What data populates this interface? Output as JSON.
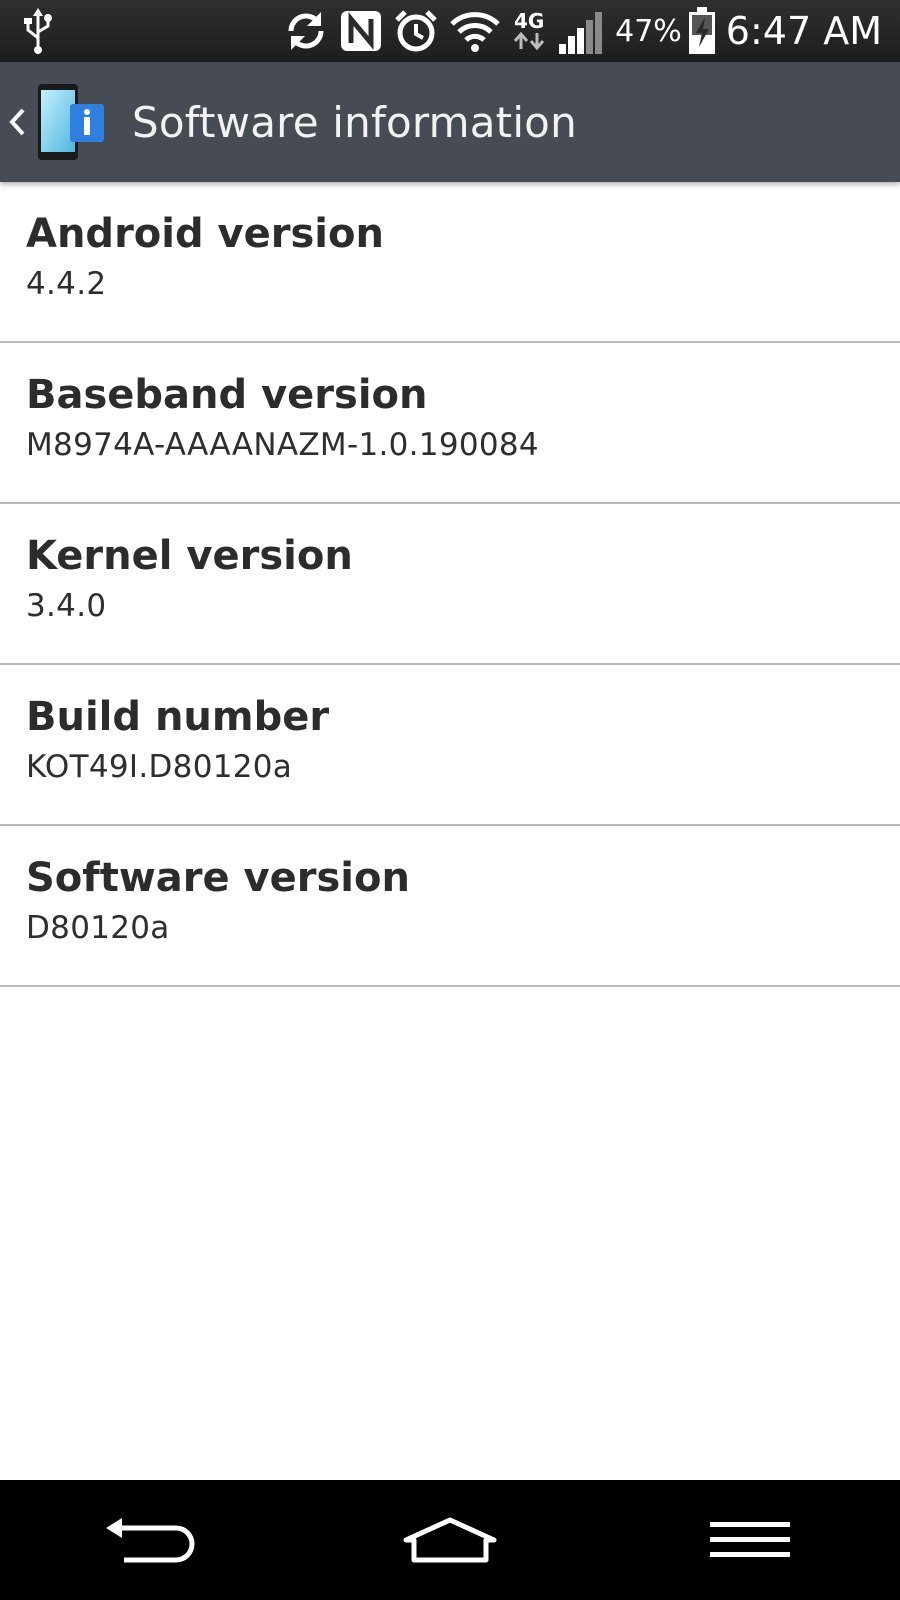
{
  "status_bar": {
    "icons": [
      "usb-icon",
      "sync-icon",
      "nfc-icon",
      "alarm-icon",
      "wifi-icon",
      "network-4g-icon",
      "signal-icon",
      "battery-charging-icon"
    ],
    "network_type": "4G",
    "battery_percent": "47%",
    "time": "6:47 AM"
  },
  "action_bar": {
    "title": "Software information",
    "icon": "software-info-icon",
    "background": "#474c54"
  },
  "items": [
    {
      "title": "Android version",
      "value": "4.4.2"
    },
    {
      "title": "Baseband version",
      "value": "M8974A-AAAANAZM-1.0.190084"
    },
    {
      "title": "Kernel version",
      "value": "3.4.0"
    },
    {
      "title": "Build number",
      "value": "KOT49I.D80120a"
    },
    {
      "title": "Software version",
      "value": "D80120a"
    }
  ],
  "nav_bar": {
    "buttons": [
      "back-icon",
      "home-icon",
      "menu-icon"
    ]
  }
}
